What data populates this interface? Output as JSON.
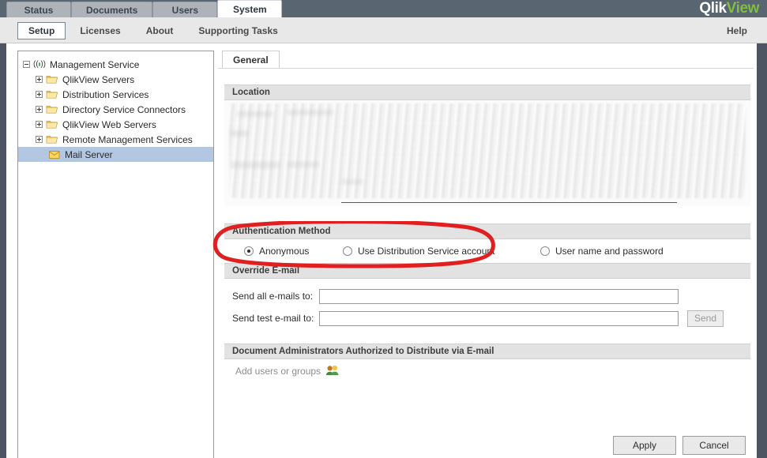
{
  "brand": {
    "part1": "Qlik",
    "part2": "View",
    "green": "#7fbf3f"
  },
  "topbar": {
    "tabs": [
      {
        "label": "Status",
        "active": false
      },
      {
        "label": "Documents",
        "active": false
      },
      {
        "label": "Users",
        "active": false
      },
      {
        "label": "System",
        "active": true
      }
    ]
  },
  "subnav": {
    "items": [
      {
        "label": "Setup",
        "active": true
      },
      {
        "label": "Licenses",
        "active": false
      },
      {
        "label": "About",
        "active": false
      },
      {
        "label": "Supporting Tasks",
        "active": false
      }
    ],
    "help_label": "Help"
  },
  "sidebar": {
    "nodes": [
      {
        "label": "Management Service",
        "level": 0,
        "icon": "broadcast-icon",
        "expander": "minus",
        "selected": false
      },
      {
        "label": "QlikView Servers",
        "level": 1,
        "icon": "folder-icon",
        "expander": "plus",
        "selected": false
      },
      {
        "label": "Distribution Services",
        "level": 1,
        "icon": "folder-icon",
        "expander": "plus",
        "selected": false
      },
      {
        "label": "Directory Service Connectors",
        "level": 1,
        "icon": "folder-icon",
        "expander": "plus",
        "selected": false
      },
      {
        "label": "QlikView Web Servers",
        "level": 1,
        "icon": "folder-icon",
        "expander": "plus",
        "selected": false
      },
      {
        "label": "Remote Management Services",
        "level": 1,
        "icon": "folder-icon",
        "expander": "plus",
        "selected": false
      },
      {
        "label": "Mail Server",
        "level": 2,
        "icon": "envelope-icon",
        "expander": "none",
        "selected": true
      }
    ]
  },
  "main": {
    "tabs": [
      {
        "label": "General",
        "active": true
      }
    ],
    "location": {
      "title": "Location",
      "redacted": true
    },
    "auth": {
      "title": "Authentication Method",
      "options": [
        {
          "label": "Anonymous",
          "selected": true
        },
        {
          "label": "Use Distribution Service account",
          "selected": false
        },
        {
          "label": "User name and password",
          "selected": false
        }
      ]
    },
    "override": {
      "title": "Override E-mail",
      "send_all_label": "Send all e-mails to:",
      "send_all_value": "",
      "send_test_label": "Send test e-mail to:",
      "send_test_value": "",
      "send_button": "Send"
    },
    "doc_admins": {
      "title": "Document Administrators Authorized to Distribute via E-mail",
      "add_label": "Add users or groups"
    },
    "footer": {
      "apply_label": "Apply",
      "cancel_label": "Cancel"
    }
  },
  "annotation": {
    "shape": "ellipse",
    "color": "#e02020",
    "target": "Authentication Method"
  }
}
